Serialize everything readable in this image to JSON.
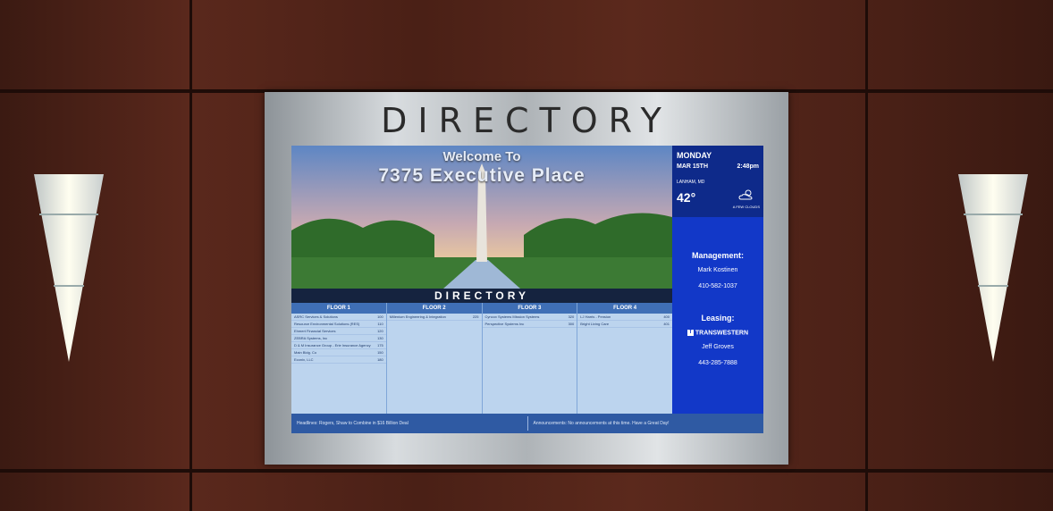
{
  "frame": {
    "title": "DIRECTORY"
  },
  "screen": {
    "welcome": "Welcome To",
    "address": "7375 Executive Place",
    "directory_band": "DIRECTORY",
    "floors": [
      {
        "label": "FLOOR 1",
        "tenants": [
          {
            "name": "ASRC Services & Solutions",
            "suite": "100"
          },
          {
            "name": "Resource Environmental Solutions (RES)",
            "suite": "110"
          },
          {
            "name": "Ehmert Financial Services",
            "suite": "120"
          },
          {
            "name": "ZEBRA Systems, Inc",
            "suite": "130"
          },
          {
            "name": "D & M Insurance Group - Erie Insurance Agency",
            "suite": "175"
          },
          {
            "name": "Main Bldg. Co",
            "suite": "150"
          },
          {
            "name": "Econix, LLC",
            "suite": "180"
          }
        ]
      },
      {
        "label": "FLOOR 2",
        "tenants": [
          {
            "name": "Millenium Engineering & Integration",
            "suite": "225"
          }
        ]
      },
      {
        "label": "FLOOR 3",
        "tenants": [
          {
            "name": "Cyncox Systems Mission Systems",
            "suite": "320"
          },
          {
            "name": "Perspective Systems Inc",
            "suite": "300"
          }
        ]
      },
      {
        "label": "FLOOR 4",
        "tenants": [
          {
            "name": "LJ Harris - Pension",
            "suite": "400"
          },
          {
            "name": "Bright Living Care",
            "suite": "401"
          }
        ]
      }
    ],
    "ticker": {
      "headlines_label": "Headlines:",
      "headline": "Rogers, Shaw to Combine in $16 Billion Deal",
      "announcements_label": "Announcements:",
      "announcement": "No announcements at this time. Have a Great Day!"
    },
    "side": {
      "day": "MONDAY",
      "date": "MAR 15TH",
      "time": "2:48pm",
      "location": "LANHAM, MD",
      "temperature": "42°",
      "conditions": "A FEW CLOUDS",
      "management_label": "Management:",
      "management_name": "Mark Kostinen",
      "management_phone": "410-582-1037",
      "leasing_label": "Leasing:",
      "leasing_company": "TRANSWESTERN",
      "leasing_name": "Jeff Groves",
      "leasing_phone": "443-285-7888"
    }
  }
}
